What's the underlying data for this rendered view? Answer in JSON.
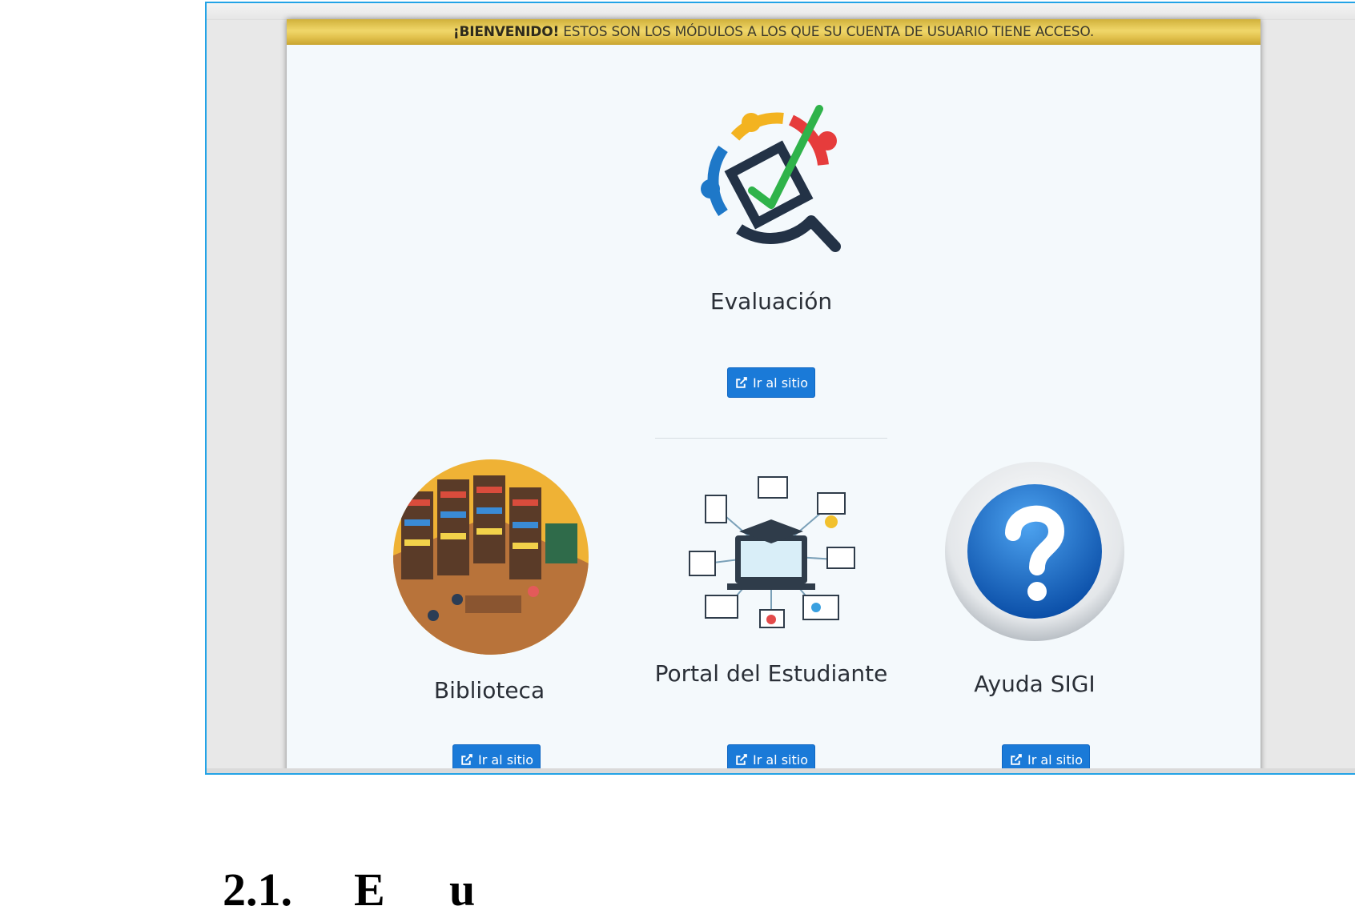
{
  "banner": {
    "strong": "¡BIENVENIDO!",
    "text": " ESTOS SON LOS MÓDULOS A LOS QUE SU CUENTA DE USUARIO TIENE ACCESO."
  },
  "modules": [
    {
      "title": "Evaluación",
      "button": "Ir al sitio",
      "icon": "evaluation-checklist-icon"
    },
    {
      "title": "Biblioteca",
      "button": "Ir al sitio",
      "icon": "library-illustration-icon"
    },
    {
      "title": "Portal del Estudiante",
      "button": "Ir al sitio",
      "icon": "student-portal-icon"
    },
    {
      "title": "Ayuda SIGI",
      "button": "Ir al sitio",
      "icon": "help-question-icon"
    }
  ],
  "document_heading": {
    "number": "2.1.",
    "word1": "E",
    "word2": "u"
  },
  "colors": {
    "banner_gold": "#e2c24e",
    "button_blue": "#1a7ad8",
    "frame_border": "#23a3e6",
    "page_bg": "#f4f9fc"
  }
}
